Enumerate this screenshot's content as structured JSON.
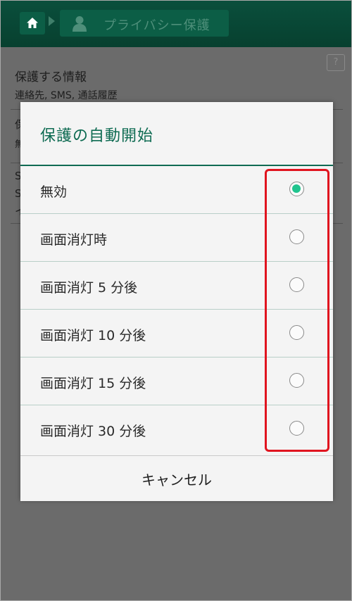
{
  "header": {
    "home_icon": "home-icon",
    "separator_icon": "breadcrumb-arrow-icon",
    "page_icon": "person-icon",
    "page_title": "プライバシー保護"
  },
  "background": {
    "help_label": "?",
    "section_title": "保護する情報",
    "section_sub": "連絡先, SMS, 通話履歴",
    "peek_row2_line1": "保",
    "peek_row2_line2": "無",
    "peek_row3_line1": "S",
    "peek_row3_line2": "S",
    "peek_row3_line3": "イ"
  },
  "dialog": {
    "title": "保護の自動開始",
    "options": [
      {
        "label": "無効",
        "selected": true
      },
      {
        "label": "画面消灯時",
        "selected": false
      },
      {
        "label": "画面消灯 5 分後",
        "selected": false
      },
      {
        "label": "画面消灯 10 分後",
        "selected": false
      },
      {
        "label": "画面消灯 15 分後",
        "selected": false
      },
      {
        "label": "画面消灯 30 分後",
        "selected": false
      }
    ],
    "cancel_label": "キャンセル"
  },
  "colors": {
    "header": "#07402f",
    "accent": "#0e6b52",
    "radio_selected": "#20c48e",
    "highlight": "#e0141f"
  }
}
